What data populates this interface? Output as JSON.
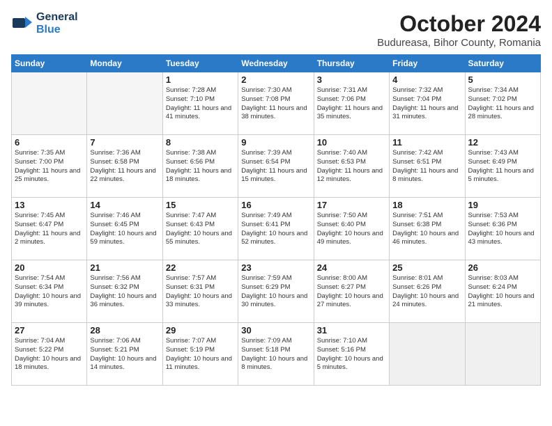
{
  "header": {
    "logo_general": "General",
    "logo_blue": "Blue",
    "month": "October 2024",
    "location": "Budureasa, Bihor County, Romania"
  },
  "weekdays": [
    "Sunday",
    "Monday",
    "Tuesday",
    "Wednesday",
    "Thursday",
    "Friday",
    "Saturday"
  ],
  "weeks": [
    [
      {
        "day": "",
        "info": "",
        "empty": true
      },
      {
        "day": "",
        "info": "",
        "empty": true
      },
      {
        "day": "1",
        "info": "Sunrise: 7:28 AM\nSunset: 7:10 PM\nDaylight: 11 hours and 41 minutes."
      },
      {
        "day": "2",
        "info": "Sunrise: 7:30 AM\nSunset: 7:08 PM\nDaylight: 11 hours and 38 minutes."
      },
      {
        "day": "3",
        "info": "Sunrise: 7:31 AM\nSunset: 7:06 PM\nDaylight: 11 hours and 35 minutes."
      },
      {
        "day": "4",
        "info": "Sunrise: 7:32 AM\nSunset: 7:04 PM\nDaylight: 11 hours and 31 minutes."
      },
      {
        "day": "5",
        "info": "Sunrise: 7:34 AM\nSunset: 7:02 PM\nDaylight: 11 hours and 28 minutes."
      }
    ],
    [
      {
        "day": "6",
        "info": "Sunrise: 7:35 AM\nSunset: 7:00 PM\nDaylight: 11 hours and 25 minutes."
      },
      {
        "day": "7",
        "info": "Sunrise: 7:36 AM\nSunset: 6:58 PM\nDaylight: 11 hours and 22 minutes."
      },
      {
        "day": "8",
        "info": "Sunrise: 7:38 AM\nSunset: 6:56 PM\nDaylight: 11 hours and 18 minutes."
      },
      {
        "day": "9",
        "info": "Sunrise: 7:39 AM\nSunset: 6:54 PM\nDaylight: 11 hours and 15 minutes."
      },
      {
        "day": "10",
        "info": "Sunrise: 7:40 AM\nSunset: 6:53 PM\nDaylight: 11 hours and 12 minutes."
      },
      {
        "day": "11",
        "info": "Sunrise: 7:42 AM\nSunset: 6:51 PM\nDaylight: 11 hours and 8 minutes."
      },
      {
        "day": "12",
        "info": "Sunrise: 7:43 AM\nSunset: 6:49 PM\nDaylight: 11 hours and 5 minutes."
      }
    ],
    [
      {
        "day": "13",
        "info": "Sunrise: 7:45 AM\nSunset: 6:47 PM\nDaylight: 11 hours and 2 minutes."
      },
      {
        "day": "14",
        "info": "Sunrise: 7:46 AM\nSunset: 6:45 PM\nDaylight: 10 hours and 59 minutes."
      },
      {
        "day": "15",
        "info": "Sunrise: 7:47 AM\nSunset: 6:43 PM\nDaylight: 10 hours and 55 minutes."
      },
      {
        "day": "16",
        "info": "Sunrise: 7:49 AM\nSunset: 6:41 PM\nDaylight: 10 hours and 52 minutes."
      },
      {
        "day": "17",
        "info": "Sunrise: 7:50 AM\nSunset: 6:40 PM\nDaylight: 10 hours and 49 minutes."
      },
      {
        "day": "18",
        "info": "Sunrise: 7:51 AM\nSunset: 6:38 PM\nDaylight: 10 hours and 46 minutes."
      },
      {
        "day": "19",
        "info": "Sunrise: 7:53 AM\nSunset: 6:36 PM\nDaylight: 10 hours and 43 minutes."
      }
    ],
    [
      {
        "day": "20",
        "info": "Sunrise: 7:54 AM\nSunset: 6:34 PM\nDaylight: 10 hours and 39 minutes."
      },
      {
        "day": "21",
        "info": "Sunrise: 7:56 AM\nSunset: 6:32 PM\nDaylight: 10 hours and 36 minutes."
      },
      {
        "day": "22",
        "info": "Sunrise: 7:57 AM\nSunset: 6:31 PM\nDaylight: 10 hours and 33 minutes."
      },
      {
        "day": "23",
        "info": "Sunrise: 7:59 AM\nSunset: 6:29 PM\nDaylight: 10 hours and 30 minutes."
      },
      {
        "day": "24",
        "info": "Sunrise: 8:00 AM\nSunset: 6:27 PM\nDaylight: 10 hours and 27 minutes."
      },
      {
        "day": "25",
        "info": "Sunrise: 8:01 AM\nSunset: 6:26 PM\nDaylight: 10 hours and 24 minutes."
      },
      {
        "day": "26",
        "info": "Sunrise: 8:03 AM\nSunset: 6:24 PM\nDaylight: 10 hours and 21 minutes."
      }
    ],
    [
      {
        "day": "27",
        "info": "Sunrise: 7:04 AM\nSunset: 5:22 PM\nDaylight: 10 hours and 18 minutes."
      },
      {
        "day": "28",
        "info": "Sunrise: 7:06 AM\nSunset: 5:21 PM\nDaylight: 10 hours and 14 minutes."
      },
      {
        "day": "29",
        "info": "Sunrise: 7:07 AM\nSunset: 5:19 PM\nDaylight: 10 hours and 11 minutes."
      },
      {
        "day": "30",
        "info": "Sunrise: 7:09 AM\nSunset: 5:18 PM\nDaylight: 10 hours and 8 minutes."
      },
      {
        "day": "31",
        "info": "Sunrise: 7:10 AM\nSunset: 5:16 PM\nDaylight: 10 hours and 5 minutes."
      },
      {
        "day": "",
        "info": "",
        "empty": true
      },
      {
        "day": "",
        "info": "",
        "empty": true
      }
    ]
  ]
}
